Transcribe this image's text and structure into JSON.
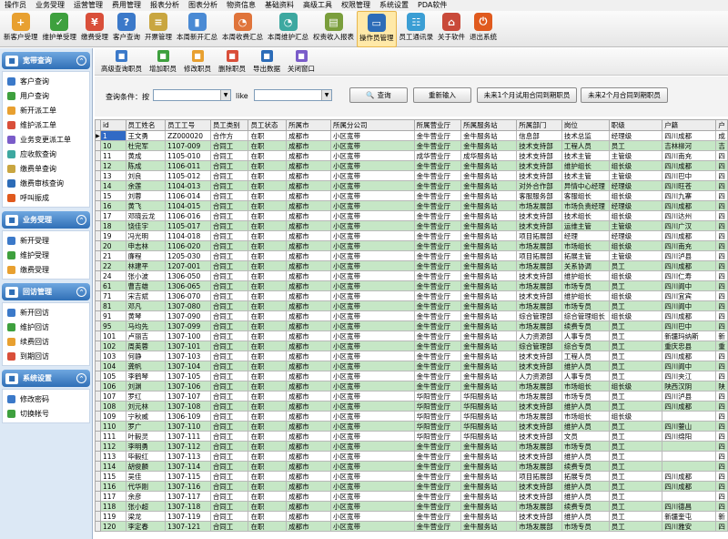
{
  "menubar": [
    "操作员",
    "业务受理",
    "运营管理",
    "费用管理",
    "报表分析",
    "图表分析",
    "物资信息",
    "基础资料",
    "高级工具",
    "权限管理",
    "系统设置",
    "PDA软件"
  ],
  "toolbar": [
    {
      "label": "新客户受理",
      "icon": "person-add-icon",
      "color": "#e8a030"
    },
    {
      "label": "维护单受理",
      "icon": "check-icon",
      "color": "#3ea03e"
    },
    {
      "label": "缴费受理",
      "icon": "user-money-icon",
      "color": "#d94f3a"
    },
    {
      "label": "客户查询",
      "icon": "person-search-icon",
      "color": "#3b79c9"
    },
    {
      "label": "开票管理",
      "icon": "invoice-icon",
      "color": "#c9a640"
    },
    {
      "label": "本周新开汇总",
      "icon": "bar-chart-icon",
      "color": "#4a8ad4"
    },
    {
      "label": "本周收费汇总",
      "icon": "pie-chart-icon",
      "color": "#e0743a"
    },
    {
      "label": "本周维护汇总",
      "icon": "pie-chart-icon",
      "color": "#3da8a0"
    },
    {
      "label": "权责收入报表",
      "icon": "report-icon",
      "color": "#7a9e3c"
    },
    {
      "label": "操作员管理",
      "icon": "monitor-icon",
      "color": "#2c6cb8"
    },
    {
      "label": "员工通讯录",
      "icon": "address-book-icon",
      "color": "#3b9ed4"
    },
    {
      "label": "关于软件",
      "icon": "home-icon",
      "color": "#c94a3a"
    },
    {
      "label": "退出系统",
      "icon": "power-icon",
      "color": "#e05a1e"
    }
  ],
  "sidebar": {
    "sections": [
      {
        "title": "宽带查询",
        "items": [
          "客户查询",
          "用户查询",
          "新开派工单",
          "维护派工单",
          "业务变更派工单",
          "应收款查询",
          "缴费单查询",
          "缴费审核查询",
          "呼叫振成"
        ]
      },
      {
        "title": "业务受理",
        "items": [
          "新开受理",
          "维护受理",
          "缴费受理"
        ]
      },
      {
        "title": "回访管理",
        "items": [
          "新开回访",
          "维护回访",
          "续费回访",
          "到期回访"
        ]
      },
      {
        "title": "系统设置",
        "items": [
          "修改密码",
          "切换帐号"
        ]
      }
    ]
  },
  "subtoolbar": [
    "高级查询职员",
    "增加职员",
    "修改职员",
    "删除职员",
    "导出数据",
    "关闭窗口"
  ],
  "query": {
    "cond_label": "查询条件：按",
    "like_label": "like",
    "search_button": "查询",
    "reset_button": "重新输入",
    "trial_1": "未来1个月试用合同到期职员",
    "trial_2": "未来2个月合同到期职员"
  },
  "grid": {
    "headers": [
      "id",
      "员工姓名",
      "员工工号",
      "员工类别",
      "员工状态",
      "所属市",
      "所属分公司",
      "所属营业厅",
      "所属服务站",
      "所属部门",
      "岗位",
      "职级",
      "户籍",
      "户"
    ],
    "rows": [
      [
        "1",
        "王文勇",
        "ZZ000020",
        "合作方",
        "在职",
        "成都市",
        "小区宽带",
        "金牛营业厅",
        "金牛服务站",
        "信息部",
        "技术总监",
        "经理级",
        "四川成都",
        "成"
      ],
      [
        "10",
        "杜完军",
        "1107-009",
        "合同工",
        "在职",
        "成都市",
        "小区宽带",
        "金牛营业厅",
        "金牛服务站",
        "技术支持部",
        "工程人员",
        "员工",
        "吉林柳河",
        "吉"
      ],
      [
        "11",
        "黄成",
        "1105-010",
        "合同工",
        "在职",
        "成都市",
        "小区宽带",
        "成华营业厅",
        "成华服务站",
        "技术支持部",
        "技术主管",
        "主管级",
        "四川南充",
        "四"
      ],
      [
        "12",
        "陈成",
        "1106-011",
        "合同工",
        "在职",
        "成都市",
        "小区宽带",
        "金牛营业厅",
        "金牛服务站",
        "技术支持部",
        "维护组长",
        "组长级",
        "四川成都",
        "四"
      ],
      [
        "13",
        "刘良",
        "1105-012",
        "合同工",
        "在职",
        "成都市",
        "小区宽带",
        "金牛营业厅",
        "金牛服务站",
        "技术支持部",
        "技术主管",
        "主管级",
        "四川巴中",
        "四"
      ],
      [
        "14",
        "余莲",
        "1104-013",
        "合同工",
        "在职",
        "成都市",
        "小区宽带",
        "金牛营业厅",
        "金牛服务站",
        "对外合作部",
        "异情中心经理",
        "经理级",
        "四川旺苍",
        "四"
      ],
      [
        "15",
        "刘蓉",
        "1106-014",
        "合同工",
        "在职",
        "成都市",
        "小区宽带",
        "金牛营业厅",
        "金牛服务站",
        "客服服务部",
        "客服组长",
        "组长级",
        "四川九寨",
        "四"
      ],
      [
        "16",
        "黄飞",
        "1104-015",
        "合同工",
        "在职",
        "成都市",
        "小区宽带",
        "金牛营业厅",
        "金牛服务站",
        "市场发展部",
        "市场负责经理",
        "经理级",
        "四川成都",
        "四"
      ],
      [
        "17",
        "邓晓云龙",
        "1106-016",
        "合同工",
        "在职",
        "成都市",
        "小区宽带",
        "金牛营业厅",
        "金牛服务站",
        "技术支持部",
        "技术组长",
        "组长级",
        "四川达州",
        "四"
      ],
      [
        "18",
        "饶佳宇",
        "1105-017",
        "合同工",
        "在职",
        "成都市",
        "小区宽带",
        "金牛营业厅",
        "金牛服务站",
        "技术支持部",
        "运维主管",
        "主管级",
        "四川广汉",
        "四"
      ],
      [
        "19",
        "冯光明",
        "1104-018",
        "合同工",
        "在职",
        "成都市",
        "小区宽带",
        "金牛营业厅",
        "金牛服务站",
        "项目拓展部",
        "经理",
        "经理级",
        "四川成都",
        "四"
      ],
      [
        "20",
        "申志林",
        "1106-020",
        "合同工",
        "在职",
        "成都市",
        "小区宽带",
        "金牛营业厅",
        "金牛服务站",
        "市场发展部",
        "市场组长",
        "组长级",
        "四川南充",
        "四"
      ],
      [
        "21",
        "廉程",
        "1205-030",
        "合同工",
        "在职",
        "成都市",
        "小区宽带",
        "金牛营业厅",
        "金牛服务站",
        "项目拓展部",
        "拓展主管",
        "主管级",
        "四川泸县",
        "四"
      ],
      [
        "22",
        "林建平",
        "1207-001",
        "合同工",
        "在职",
        "成都市",
        "小区宽带",
        "金牛营业厅",
        "金牛服务站",
        "市场发展部",
        "关系协调",
        "员工",
        "四川成都",
        "四"
      ],
      [
        "24",
        "张小波",
        "1306-050",
        "合同工",
        "在职",
        "成都市",
        "小区宽带",
        "金牛营业厅",
        "金牛服务站",
        "技术支持部",
        "维护组长",
        "组长级",
        "四川仁寿",
        "四"
      ],
      [
        "61",
        "曹吉雄",
        "1306-065",
        "合同工",
        "在职",
        "成都市",
        "小区宽带",
        "金牛营业厅",
        "金牛服务站",
        "市场发展部",
        "市场专员",
        "员工",
        "四川阆中",
        "四"
      ],
      [
        "71",
        "宋吉斌",
        "1306-070",
        "合同工",
        "在职",
        "成都市",
        "小区宽带",
        "金牛营业厅",
        "金牛服务站",
        "技术支持部",
        "维护组长",
        "组长级",
        "四川宜宾",
        "四"
      ],
      [
        "81",
        "邓凡",
        "1307-080",
        "合同工",
        "在职",
        "成都市",
        "小区宽带",
        "金牛营业厅",
        "金牛服务站",
        "市场发展部",
        "市场专员",
        "员工",
        "四川阆中",
        "四"
      ],
      [
        "91",
        "黄琴",
        "1307-090",
        "合同工",
        "在职",
        "成都市",
        "小区宽带",
        "金牛营业厅",
        "金牛服务站",
        "综合管理部",
        "综合管理组长",
        "组长级",
        "四川成都",
        "四"
      ],
      [
        "95",
        "马均先",
        "1307-099",
        "合同工",
        "在职",
        "成都市",
        "小区宽带",
        "金牛营业厅",
        "金牛服务站",
        "市场发展部",
        "续费专员",
        "员工",
        "四川巴中",
        "四"
      ],
      [
        "101",
        "卢丽吉",
        "1307-100",
        "合同工",
        "在职",
        "成都市",
        "小区宽带",
        "金牛营业厅",
        "金牛服务站",
        "人力资源部",
        "人事专员",
        "员工",
        "新疆玛纳斯",
        "新"
      ],
      [
        "102",
        "周英蓉",
        "1307-101",
        "合同工",
        "在职",
        "成都市",
        "小区宽带",
        "金牛营业厅",
        "金牛服务站",
        "综合管理部",
        "综合专员",
        "员工",
        "重庆忠县",
        "重"
      ],
      [
        "103",
        "何静",
        "1307-103",
        "合同工",
        "在职",
        "成都市",
        "小区宽带",
        "金牛营业厅",
        "金牛服务站",
        "技术支持部",
        "工程人员",
        "员工",
        "四川成都",
        "四"
      ],
      [
        "104",
        "龚帆",
        "1307-104",
        "合同工",
        "在职",
        "成都市",
        "小区宽带",
        "金牛营业厅",
        "金牛服务站",
        "技术支持部",
        "维护人员",
        "员工",
        "四川阆中",
        "四"
      ],
      [
        "105",
        "李鹤琴",
        "1307-105",
        "合同工",
        "在职",
        "成都市",
        "小区宽带",
        "金牛营业厅",
        "金牛服务站",
        "人力资源部",
        "人事专员",
        "员工",
        "四川夹江",
        "四"
      ],
      [
        "106",
        "刘渊",
        "1307-106",
        "合同工",
        "在职",
        "成都市",
        "小区宽带",
        "金牛营业厅",
        "金牛服务站",
        "市场发展部",
        "市场组长",
        "组长级",
        "陕西汉阴",
        "陕"
      ],
      [
        "107",
        "罗红",
        "1307-107",
        "合同工",
        "在职",
        "成都市",
        "小区宽带",
        "华阳营业厅",
        "华阳服务站",
        "市场发展部",
        "市场专员",
        "员工",
        "四川泸县",
        "四"
      ],
      [
        "108",
        "刘元林",
        "1307-108",
        "合同工",
        "在职",
        "成都市",
        "小区宽带",
        "华阳营业厅",
        "华阳服务站",
        "技术支持部",
        "维护人员",
        "员工",
        "四川成都",
        "四"
      ],
      [
        "109",
        "宁秋威",
        "1306-109",
        "合同工",
        "在职",
        "成都市",
        "小区宽带",
        "华阳营业厅",
        "华阳服务站",
        "市场发展部",
        "市场组长",
        "组长级",
        "",
        "四"
      ],
      [
        "110",
        "罗广",
        "1307-110",
        "合同工",
        "在职",
        "成都市",
        "小区宽带",
        "华阳营业厅",
        "华阳服务站",
        "技术支持部",
        "维护人员",
        "员工",
        "四川蓥山",
        "四"
      ],
      [
        "111",
        "叶毅灵",
        "1307-111",
        "合同工",
        "在职",
        "成都市",
        "小区宽带",
        "华阳营业厅",
        "华阳服务站",
        "技术支持部",
        "文员",
        "员工",
        "四川绵阳",
        "四"
      ],
      [
        "112",
        "李明勇",
        "1307-112",
        "合同工",
        "在职",
        "成都市",
        "小区宽带",
        "金牛营业厅",
        "金牛服务站",
        "市场发展部",
        "市场专员",
        "员工",
        "",
        "四"
      ],
      [
        "113",
        "毕毅红",
        "1307-113",
        "合同工",
        "在职",
        "成都市",
        "小区宽带",
        "金牛营业厅",
        "金牛服务站",
        "技术支持部",
        "维护人员",
        "员工",
        "",
        "四"
      ],
      [
        "114",
        "胡俊麟",
        "1307-114",
        "合同工",
        "在职",
        "成都市",
        "小区宽带",
        "金牛营业厅",
        "金牛服务站",
        "市场发展部",
        "续费专员",
        "员工",
        "",
        "四"
      ],
      [
        "115",
        "吴佳",
        "1307-115",
        "合同工",
        "在职",
        "成都市",
        "小区宽带",
        "金牛营业厅",
        "金牛服务站",
        "项目拓展部",
        "拓展专员",
        "员工",
        "四川成都",
        "四"
      ],
      [
        "116",
        "代华刚",
        "1307-116",
        "合同工",
        "在职",
        "成都市",
        "小区宽带",
        "金牛营业厅",
        "金牛服务站",
        "技术支持部",
        "维护人员",
        "员工",
        "四川成都",
        "四"
      ],
      [
        "117",
        "余彦",
        "1307-117",
        "合同工",
        "在职",
        "成都市",
        "小区宽带",
        "金牛营业厅",
        "金牛服务站",
        "技术支持部",
        "维护人员",
        "员工",
        "",
        "四"
      ],
      [
        "118",
        "张小超",
        "1307-118",
        "合同工",
        "在职",
        "成都市",
        "小区宽带",
        "金牛营业厅",
        "金牛服务站",
        "市场发展部",
        "续费专员",
        "员工",
        "四川德昌",
        "四"
      ],
      [
        "119",
        "梁龙",
        "1307-119",
        "合同工",
        "在职",
        "成都市",
        "小区宽带",
        "金牛营业厅",
        "金牛服务站",
        "技术支持部",
        "维护人员",
        "员工",
        "新疆奎屯",
        "新"
      ],
      [
        "120",
        "李定春",
        "1307-121",
        "合同工",
        "在职",
        "成都市",
        "小区宽带",
        "金牛营业厅",
        "金牛服务站",
        "市场发展部",
        "市场专员",
        "员工",
        "四川雅安",
        "四"
      ]
    ]
  }
}
